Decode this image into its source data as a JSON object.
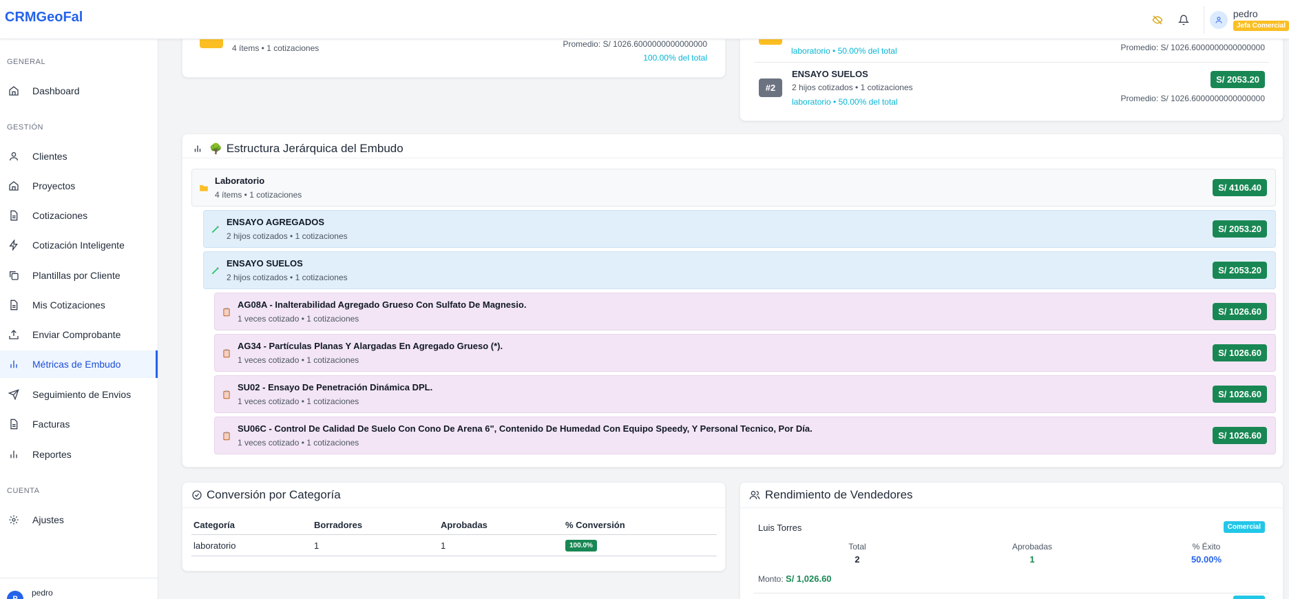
{
  "app": {
    "brand": "CRMGeoFal"
  },
  "topbar": {
    "user_name": "pedro",
    "user_role": "Jefa Comercial"
  },
  "sidebar": {
    "section_general": "GENERAL",
    "section_gestion": "GESTIÓN",
    "section_cuenta": "CUENTA",
    "items": [
      {
        "label": "Dashboard",
        "icon": "home-icon"
      },
      {
        "label": "Clientes",
        "icon": "user-icon"
      },
      {
        "label": "Proyectos",
        "icon": "home-icon"
      },
      {
        "label": "Cotizaciones",
        "icon": "document-icon"
      },
      {
        "label": "Cotización Inteligente",
        "icon": "lightning-icon"
      },
      {
        "label": "Plantillas por Cliente",
        "icon": "copy-icon"
      },
      {
        "label": "Mis Cotizaciones",
        "icon": "document-icon"
      },
      {
        "label": "Enviar Comprobante",
        "icon": "upload-icon"
      },
      {
        "label": "Métricas de Embudo",
        "icon": "bar-chart-icon"
      },
      {
        "label": "Seguimiento de Envios",
        "icon": "send-icon"
      },
      {
        "label": "Facturas",
        "icon": "document-icon"
      },
      {
        "label": "Reportes",
        "icon": "bar-chart-icon"
      },
      {
        "label": "Ajustes",
        "icon": "gear-icon"
      }
    ],
    "footer_user": "pedro",
    "footer_avatar": "P"
  },
  "top_left_card": {
    "subtitle": "4 ítems • 1 cotizaciones",
    "average": "Promedio: S/ 1026.6000000000000000",
    "share": "100.00% del total"
  },
  "top_right_card": {
    "row1_sub": "laboratorio • 50.00% del total",
    "row1_average": "Promedio: S/ 1026.6000000000000000",
    "row2_rank": "#2",
    "row2_title": "ENSAYO SUELOS",
    "row2_sub": "2 hijos cotizados • 1 cotizaciones",
    "row2_cat": "laboratorio • 50.00% del total",
    "row2_amount": "S/ 2053.20",
    "row2_average": "Promedio: S/ 1026.6000000000000000"
  },
  "hierarchy": {
    "title": "Estructura Jerárquica del Embudo",
    "title_emoji": "🌳",
    "root": {
      "title": "Laboratorio",
      "sub": "4 ítems • 1 cotizaciones",
      "amount": "S/ 4106.40"
    },
    "groups": [
      {
        "title": "ENSAYO AGREGADOS",
        "sub": "2 hijos cotizados • 1 cotizaciones",
        "amount": "S/ 2053.20"
      },
      {
        "title": "ENSAYO SUELOS",
        "sub": "2 hijos cotizados • 1 cotizaciones",
        "amount": "S/ 2053.20"
      }
    ],
    "items": [
      {
        "title": "AG08A - Inalterabilidad Agregado Grueso Con Sulfato De Magnesio.",
        "sub": "1 veces cotizado • 1 cotizaciones",
        "amount": "S/ 1026.60"
      },
      {
        "title": "AG34 - Partículas Planas Y Alargadas En Agregado Grueso (*).",
        "sub": "1 veces cotizado • 1 cotizaciones",
        "amount": "S/ 1026.60"
      },
      {
        "title": "SU02 - Ensayo De Penetración Dinámica DPL.",
        "sub": "1 veces cotizado • 1 cotizaciones",
        "amount": "S/ 1026.60"
      },
      {
        "title": "SU06C - Control De Calidad De Suelo Con Cono De Arena 6\", Contenido De Humedad Con Equipo Speedy, Y Personal Tecnico, Por Día.",
        "sub": "1 veces cotizado • 1 cotizaciones",
        "amount": "S/ 1026.60"
      }
    ]
  },
  "conversion": {
    "title": "Conversión por Categoría",
    "headers": [
      "Categoría",
      "Borradores",
      "Aprobadas",
      "% Conversión"
    ],
    "rows": [
      {
        "categoria": "laboratorio",
        "borradores": "1",
        "aprobadas": "1",
        "conversion": "100.0%"
      }
    ]
  },
  "sellers": {
    "title": "Rendimiento de Vendedores",
    "seller": {
      "name": "Luis Torres",
      "badge": "Comercial",
      "total_label": "Total",
      "total": "2",
      "approved_label": "Aprobadas",
      "approved": "1",
      "success_label": "% Éxito",
      "success": "50.00%",
      "amount_label": "Monto:",
      "amount": "S/ 1,026.60"
    }
  },
  "colors": {
    "accent": "#2563eb",
    "money": "#198754",
    "cyan": "#06b6d4",
    "group_bg": "#e0effa",
    "item_bg": "#f3e5f5"
  }
}
